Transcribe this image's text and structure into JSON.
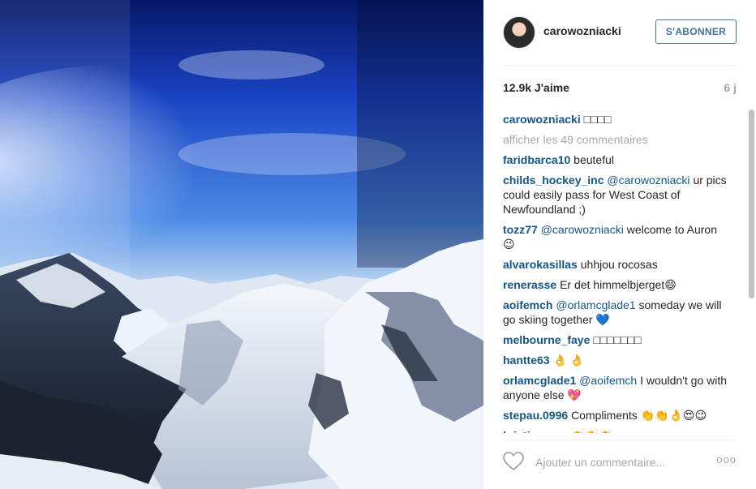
{
  "header": {
    "username": "carowozniacki",
    "follow_label": "S'ABONNER"
  },
  "stats": {
    "likes": "12.9k J'aime",
    "age": "6 j"
  },
  "caption": {
    "user": "carowozniacki",
    "text": "□□□□"
  },
  "more_comments": "afficher les 49 commentaires",
  "comments": [
    {
      "user": "faridbarca10",
      "mention": "",
      "text": "beuteful"
    },
    {
      "user": "childs_hockey_inc",
      "mention": "@carowozniacki",
      "text": "ur pics could easily pass for West Coast of Newfoundland ;)"
    },
    {
      "user": "tozz77",
      "mention": "@carowozniacki",
      "text": "welcome to Auron 😉"
    },
    {
      "user": "alvarokasillas",
      "mention": "",
      "text": "uhhjou rocosas"
    },
    {
      "user": "renerasse",
      "mention": "",
      "text": "Er det himmelbjerget😄"
    },
    {
      "user": "aoifemch",
      "mention": "@orlamcglade1",
      "text": "someday we will go skiing together 💙"
    },
    {
      "user": "melbourne_faye",
      "mention": "",
      "text": "□□□□□□□"
    },
    {
      "user": "hantte63",
      "mention": "",
      "text": "👌 👌"
    },
    {
      "user": "orlamcglade1",
      "mention": "@aoifemch",
      "text": "I wouldn't go with anyone else 💖"
    },
    {
      "user": "stepau.0996",
      "mention": "",
      "text": "Compliments 👏👏👌😍😉"
    },
    {
      "user": "kristingrove",
      "mention": "",
      "text": "👏👏👏"
    }
  ],
  "footer": {
    "comment_placeholder": "Ajouter un commentaire...",
    "options_label": "ooo"
  },
  "icons": {
    "heart": "heart-icon",
    "options": "more-options-icon"
  }
}
